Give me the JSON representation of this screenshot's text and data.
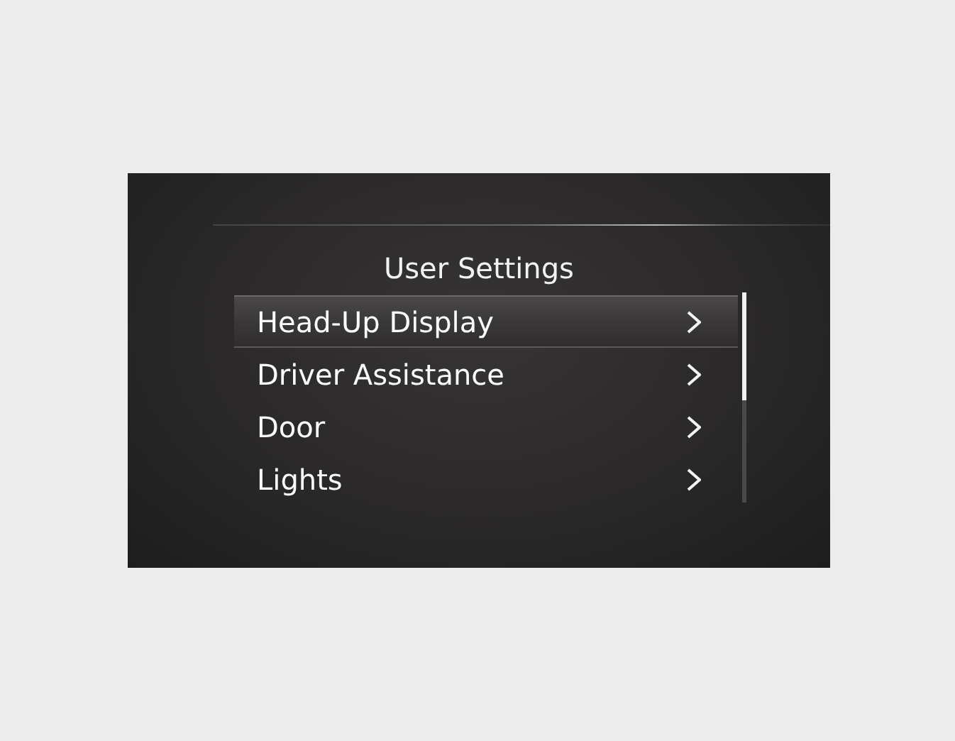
{
  "title": "User Settings",
  "items": [
    {
      "label": "Head-Up Display",
      "selected": true
    },
    {
      "label": "Driver Assistance",
      "selected": false
    },
    {
      "label": "Door",
      "selected": false
    },
    {
      "label": "Lights",
      "selected": false
    }
  ]
}
